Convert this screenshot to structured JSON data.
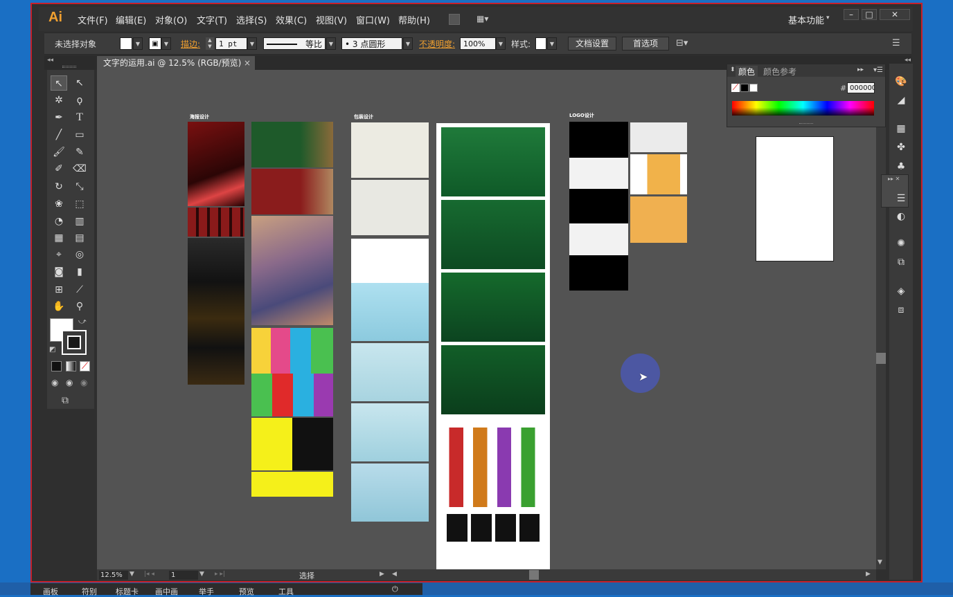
{
  "app": {
    "logo": "Ai",
    "menu": [
      "文件(F)",
      "编辑(E)",
      "对象(O)",
      "文字(T)",
      "选择(S)",
      "效果(C)",
      "视图(V)",
      "窗口(W)",
      "帮助(H)"
    ],
    "workspace": "基本功能",
    "window_buttons": [
      "–",
      "□",
      "✕"
    ]
  },
  "control_bar": {
    "selection": "未选择对象",
    "stroke_label": "描边:",
    "stroke_weight": "1 pt",
    "stroke_profile": "等比",
    "brush": "3 点圆形",
    "opacity_label": "不透明度:",
    "opacity_value": "100%",
    "style_label": "样式:",
    "doc_setup": "文档设置",
    "preferences": "首选项"
  },
  "document": {
    "tab": "文字的运用.ai @ 12.5% (RGB/预览)"
  },
  "artboards": {
    "poster": "海报设计",
    "packaging": "包装设计",
    "logo": "LOGO设计"
  },
  "color_panel": {
    "tab_color": "颜色",
    "tab_guide": "颜色参考",
    "hex_label": "#",
    "hex_value": "000000"
  },
  "status_bar": {
    "zoom": "12.5%",
    "artboard_num": "1",
    "tool": "选择"
  },
  "taskbar": {
    "items": [
      "画板",
      "符别",
      "标题卡",
      "画中画",
      "举手",
      "预览",
      "工具"
    ]
  },
  "colors": {
    "frame_red": "#c8202a",
    "accent_orange": "#f0a030",
    "canvas": "#535353"
  }
}
